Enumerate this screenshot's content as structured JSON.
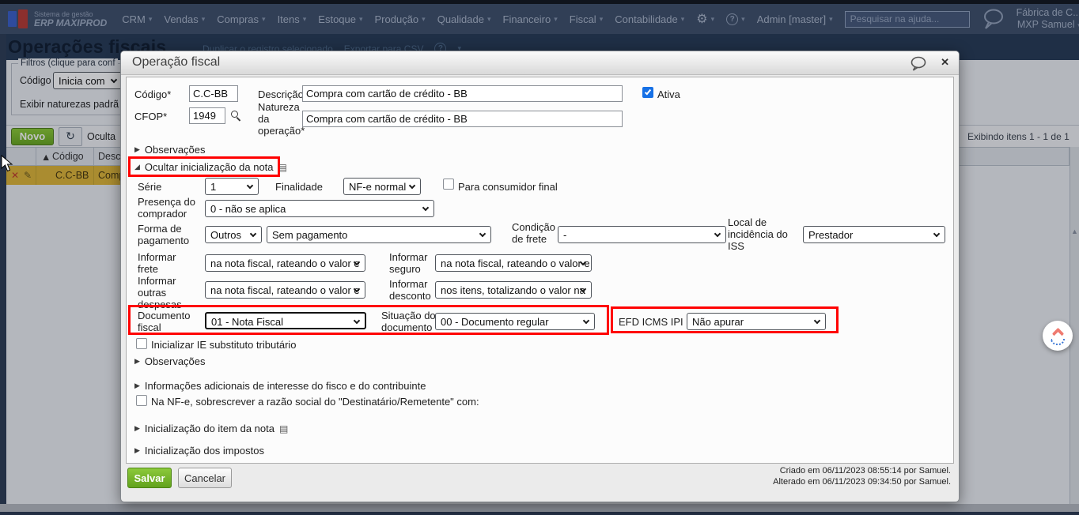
{
  "icons": {
    "caret": "▾",
    "tri_collapsed": "▶",
    "tri_expanded": "◢",
    "doc_sheet": "▤",
    "sort_asc": "▲",
    "close": "✕",
    "refresh": "↻",
    "help_q": "?",
    "row_delete": "✕",
    "row_edit": "✎",
    "scroll_up": "▲"
  },
  "colors": {
    "accent_green": "#79bf27",
    "row_selected": "#dfb637",
    "annotation_red": "#ff0000",
    "checkbox_blue": "#1771e6"
  },
  "topnav": {
    "logo_line1": "Sistema de gestão",
    "logo_line2": "ERP MAXIPROD",
    "menus": [
      "CRM",
      "Vendas",
      "Compras",
      "Itens",
      "Estoque",
      "Produção",
      "Qualidade",
      "Financeiro",
      "Fiscal",
      "Contabilidade"
    ],
    "admin_label": "Admin [master]",
    "search_placeholder": "Pesquisar na ajuda...",
    "account_line1": "Fábrica de C...",
    "account_line2": "MXP Samuel"
  },
  "page": {
    "title": "Operações fiscais",
    "link_duplicar": "Duplicar o registro selecionado",
    "link_exportar": "Exportar para CSV",
    "filters_legend": "Filtros (clique para conf",
    "codigo_filter_label": "Código",
    "codigo_filter_value": "Inicia com",
    "exibir_text": "Exibir naturezas padrã",
    "novo_button": "Novo",
    "oculta_text": "Oculta",
    "grid": {
      "col_codigo": "Código",
      "col_desc": "Descr",
      "row_codigo": "C.C-BB",
      "row_desc": "Comp"
    },
    "paging": "Exibindo itens 1 - 1 de 1"
  },
  "modal": {
    "title": "Operação fiscal",
    "sections": {
      "observacoes1": "Observações",
      "ocultar_inicializacao": "Ocultar inicialização da nota",
      "observacoes2": "Observações",
      "info_adicionais": "Informações adicionais de interesse do fisco e do contribuinte",
      "init_item": "Inicialização do item da nota",
      "init_impostos": "Inicialização dos impostos"
    },
    "form": {
      "codigo_label": "Código*",
      "codigo_value": "C.C-BB",
      "descricao_label": "Descrição*",
      "descricao_value": "Compra com cartão de crédito - BB",
      "ativa_label": "Ativa",
      "cfop_label": "CFOP*",
      "cfop_value": "1949",
      "natureza_label": "Natureza da operação*",
      "natureza_value": "Compra com cartão de crédito - BB",
      "serie_label": "Série",
      "serie_value": "1",
      "finalidade_label": "Finalidade",
      "finalidade_value": "NF-e normal",
      "consumidor_label": "Para consumidor final",
      "presenca_label": "Presença do comprador",
      "presenca_value": "0 - não se aplica",
      "forma_label": "Forma de pagamento",
      "forma_value1": "Outros",
      "forma_value2": "Sem pagamento",
      "condicao_label": "Condição de frete",
      "condicao_value": "-",
      "local_label": "Local de incidência do ISS",
      "local_value": "Prestador",
      "frete_label": "Informar frete",
      "frete_value": "na nota fiscal, rateando o valor e",
      "seguro_label": "Informar seguro",
      "seguro_value": "na nota fiscal, rateando o valor e",
      "outras_label": "Informar outras despesas",
      "outras_value": "na nota fiscal, rateando o valor e",
      "desconto_label": "Informar desconto",
      "desconto_value": "nos itens, totalizando o valor na",
      "documento_label": "Documento fiscal",
      "documento_value": "01 - Nota Fiscal",
      "situacao_label": "Situação do documento",
      "situacao_value": "00 - Documento regular",
      "efd_label": "EFD ICMS IPI",
      "efd_value": "Não apurar",
      "ie_checkbox_label": "Inicializar IE substituto tributário",
      "nfe_checkbox_label": "Na NF-e, sobrescrever a razão social do \"Destinatário/Remetente\" com:"
    },
    "footer": {
      "salvar": "Salvar",
      "cancelar": "Cancelar",
      "criado": "Criado em 06/11/2023 08:55:14 por Samuel.",
      "alterado": "Alterado em 06/11/2023 09:34:50 por Samuel."
    }
  }
}
